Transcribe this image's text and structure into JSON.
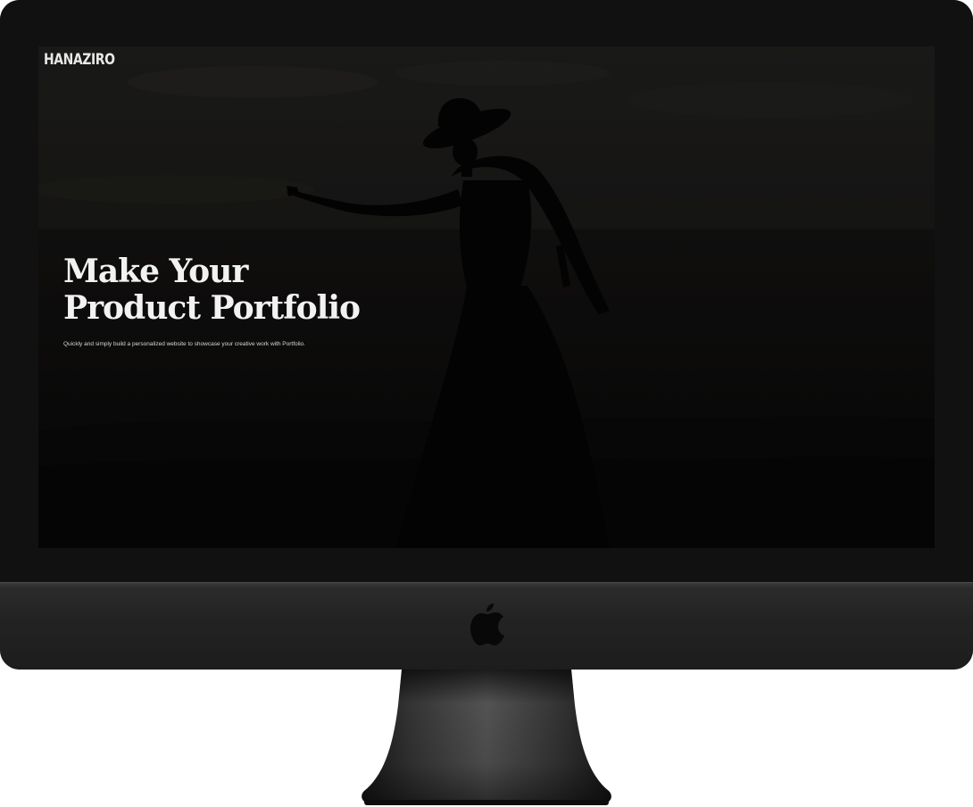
{
  "device": {
    "type": "imac",
    "logo_icon": "apple-logo-icon"
  },
  "site": {
    "logo": "HANAZIRO"
  },
  "hero": {
    "title_line1": "Make Your",
    "title_line2": "Product Portfolio",
    "subtitle": "Quickly and simply build a personalized website to showcase your creative work with Portfolio.",
    "background": "silhouette-of-woman-in-hat-at-dusk"
  },
  "colors": {
    "screen_bg": "#0b0b0b",
    "text": "#f2f2f2",
    "bezel": "#111111",
    "chin": "#232323"
  }
}
